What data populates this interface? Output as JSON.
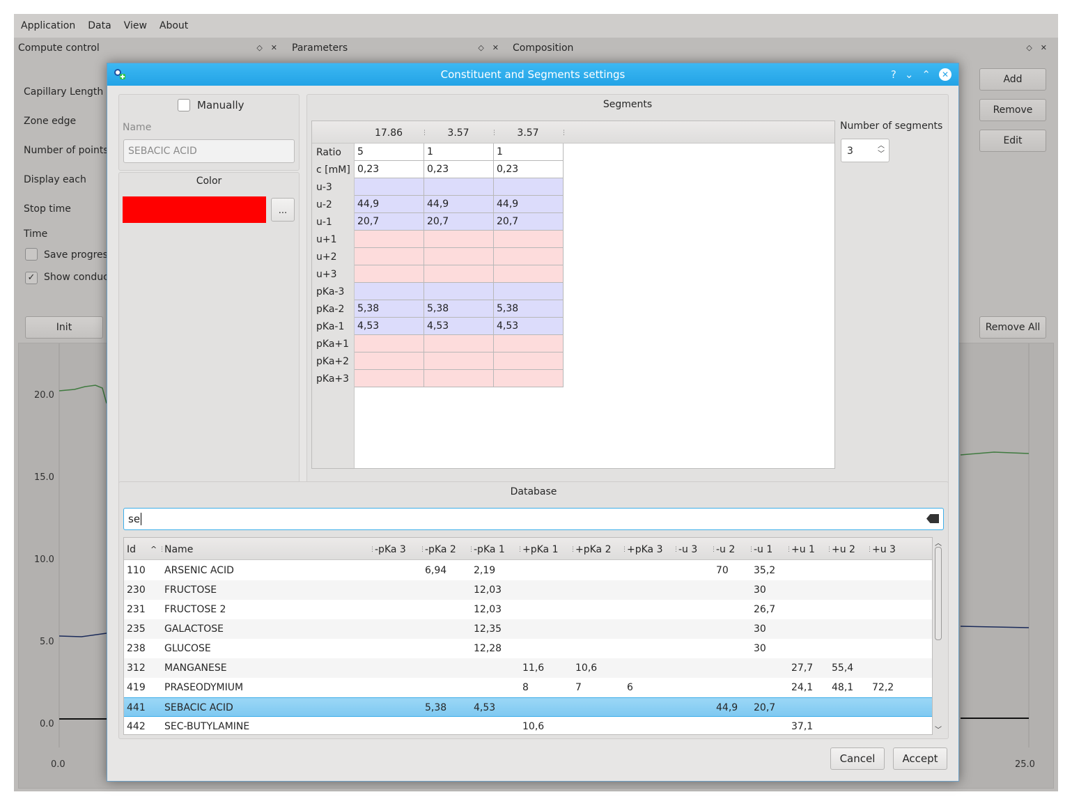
{
  "menu": [
    "Application",
    "Data",
    "View",
    "About"
  ],
  "docks": {
    "compute_control": "Compute control",
    "parameters": "Parameters",
    "composition": "Composition",
    "dock_float": "◇",
    "dock_close": "✕"
  },
  "compute_labels": [
    "Capillary Length",
    "Zone edge",
    "Number of points",
    "Display each",
    "Stop time",
    "Time"
  ],
  "compute_checks": {
    "save": "Save progress",
    "show": "Show conductivity"
  },
  "init_button": "Init",
  "composition_buttons": {
    "add": "Add",
    "remove": "Remove",
    "edit": "Edit",
    "remove_all": "Remove All"
  },
  "plot": {
    "y_ticks": [
      "20.0",
      "15.0",
      "10.0",
      "5.0",
      "0.0"
    ],
    "x_ticks": [
      "0.0",
      "25.0"
    ]
  },
  "dialog": {
    "title": "Constituent and Segments settings",
    "help": "?",
    "minimize": "⌄",
    "maximize": "⌃",
    "close": "✕",
    "manually_label": "Manually",
    "name_label": "Name",
    "name_value": "SEBACIC ACID",
    "color_label": "Color",
    "color_value": "#ff0000",
    "color_button": "...",
    "segments_title": "Segments",
    "segment_headers": [
      "17.86",
      "3.57",
      "3.57"
    ],
    "number_of_segments_label": "Number of segments",
    "number_of_segments": "3",
    "segment_rows": [
      {
        "label": "Ratio",
        "type": "white",
        "values": [
          "5",
          "1",
          "1"
        ]
      },
      {
        "label": "c [mM]",
        "type": "white",
        "values": [
          "0,23",
          "0,23",
          "0,23"
        ]
      },
      {
        "label": "u-3",
        "type": "blue",
        "values": [
          "",
          "",
          ""
        ]
      },
      {
        "label": "u-2",
        "type": "blue",
        "values": [
          "44,9",
          "44,9",
          "44,9"
        ]
      },
      {
        "label": "u-1",
        "type": "blue",
        "values": [
          "20,7",
          "20,7",
          "20,7"
        ]
      },
      {
        "label": "u+1",
        "type": "pink",
        "values": [
          "",
          "",
          ""
        ]
      },
      {
        "label": "u+2",
        "type": "pink",
        "values": [
          "",
          "",
          ""
        ]
      },
      {
        "label": "u+3",
        "type": "pink",
        "values": [
          "",
          "",
          ""
        ]
      },
      {
        "label": "pKa-3",
        "type": "blue",
        "values": [
          "",
          "",
          ""
        ]
      },
      {
        "label": "pKa-2",
        "type": "blue",
        "values": [
          "5,38",
          "5,38",
          "5,38"
        ]
      },
      {
        "label": "pKa-1",
        "type": "blue",
        "values": [
          "4,53",
          "4,53",
          "4,53"
        ]
      },
      {
        "label": "pKa+1",
        "type": "pink",
        "values": [
          "",
          "",
          ""
        ]
      },
      {
        "label": "pKa+2",
        "type": "pink",
        "values": [
          "",
          "",
          ""
        ]
      },
      {
        "label": "pKa+3",
        "type": "pink",
        "values": [
          "",
          "",
          ""
        ]
      }
    ],
    "database_title": "Database",
    "search_value": "se",
    "db_columns": [
      "Id",
      "Name",
      "-pKa 3",
      "-pKa 2",
      "-pKa 1",
      "+pKa 1",
      "+pKa 2",
      "+pKa 3",
      "-u 3",
      "-u 2",
      "-u 1",
      "+u 1",
      "+u 2",
      "+u 3"
    ],
    "sort_indicator": "^",
    "db_rows": [
      [
        "110",
        "ARSENIC ACID",
        "",
        "6,94",
        "2,19",
        "",
        "",
        "",
        "",
        "70",
        "35,2",
        "",
        "",
        ""
      ],
      [
        "230",
        "FRUCTOSE",
        "",
        "",
        "12,03",
        "",
        "",
        "",
        "",
        "",
        "30",
        "",
        "",
        ""
      ],
      [
        "231",
        "FRUCTOSE 2",
        "",
        "",
        "12,03",
        "",
        "",
        "",
        "",
        "",
        "26,7",
        "",
        "",
        ""
      ],
      [
        "235",
        "GALACTOSE",
        "",
        "",
        "12,35",
        "",
        "",
        "",
        "",
        "",
        "30",
        "",
        "",
        ""
      ],
      [
        "238",
        "GLUCOSE",
        "",
        "",
        "12,28",
        "",
        "",
        "",
        "",
        "",
        "30",
        "",
        "",
        ""
      ],
      [
        "312",
        "MANGANESE",
        "",
        "",
        "",
        "11,6",
        "10,6",
        "",
        "",
        "",
        "",
        "27,7",
        "55,4",
        ""
      ],
      [
        "419",
        "PRASEODYMIUM",
        "",
        "",
        "",
        "8",
        "7",
        "6",
        "",
        "",
        "",
        "24,1",
        "48,1",
        "72,2"
      ],
      [
        "441",
        "SEBACIC ACID",
        "",
        "5,38",
        "4,53",
        "",
        "",
        "",
        "",
        "44,9",
        "20,7",
        "",
        "",
        ""
      ],
      [
        "442",
        "SEC-BUTYLAMINE",
        "",
        "",
        "",
        "10,6",
        "",
        "",
        "",
        "",
        "",
        "37,1",
        "",
        ""
      ]
    ],
    "selected_row": 7,
    "cancel": "Cancel",
    "accept": "Accept"
  }
}
